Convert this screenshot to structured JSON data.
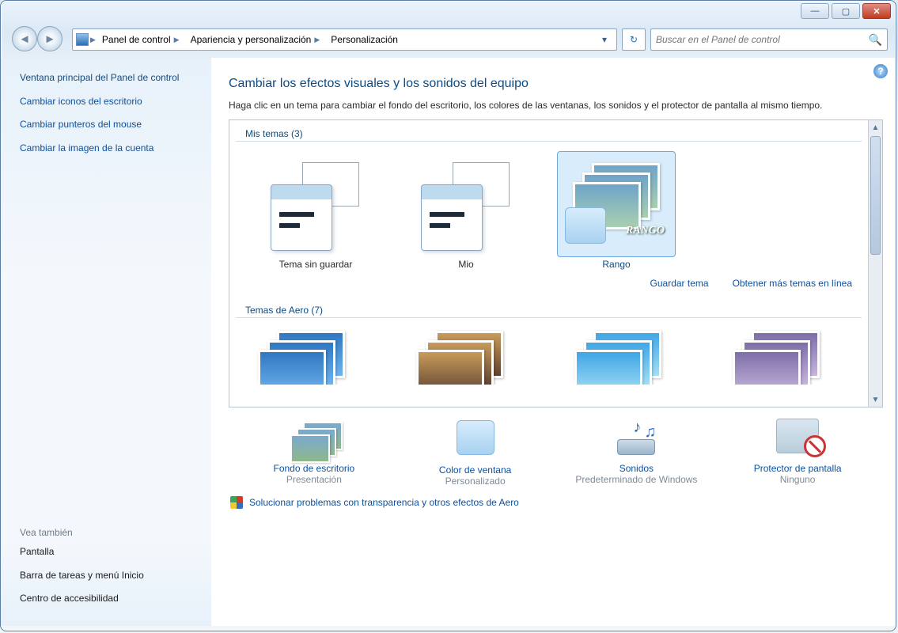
{
  "window": {
    "btn_min": "—",
    "btn_max": "▢",
    "btn_close": "✕"
  },
  "breadcrumb": {
    "items": [
      {
        "label": "Panel de control"
      },
      {
        "label": "Apariencia y personalización"
      },
      {
        "label": "Personalización"
      }
    ]
  },
  "search": {
    "placeholder": "Buscar en el Panel de control"
  },
  "sidebar": {
    "home": "Ventana principal del Panel de control",
    "links": [
      "Cambiar iconos del escritorio",
      "Cambiar punteros del mouse",
      "Cambiar la imagen de la cuenta"
    ],
    "see_also_header": "Vea también",
    "see_also": [
      "Pantalla",
      "Barra de tareas y menú Inicio",
      "Centro de accesibilidad"
    ]
  },
  "main": {
    "heading": "Cambiar los efectos visuales y los sonidos del equipo",
    "desc": "Haga clic en un tema para cambiar el fondo del escritorio, los colores de las ventanas, los sonidos y el protector de pantalla al mismo tiempo.",
    "group1_title": "Mis temas (3)",
    "themes": [
      {
        "name": "Tema sin guardar"
      },
      {
        "name": "Mio"
      },
      {
        "name": "Rango"
      }
    ],
    "save_link": "Guardar tema",
    "more_link": "Obtener más temas en línea",
    "group2_title": "Temas de Aero (7)"
  },
  "quick": {
    "bg": {
      "title": "Fondo de escritorio",
      "sub": "Presentación"
    },
    "color": {
      "title": "Color de ventana",
      "sub": "Personalizado"
    },
    "sound": {
      "title": "Sonidos",
      "sub": "Predeterminado de Windows"
    },
    "ss": {
      "title": "Protector de pantalla",
      "sub": "Ninguno"
    }
  },
  "trouble": "Solucionar problemas con transparencia y otros efectos de Aero"
}
